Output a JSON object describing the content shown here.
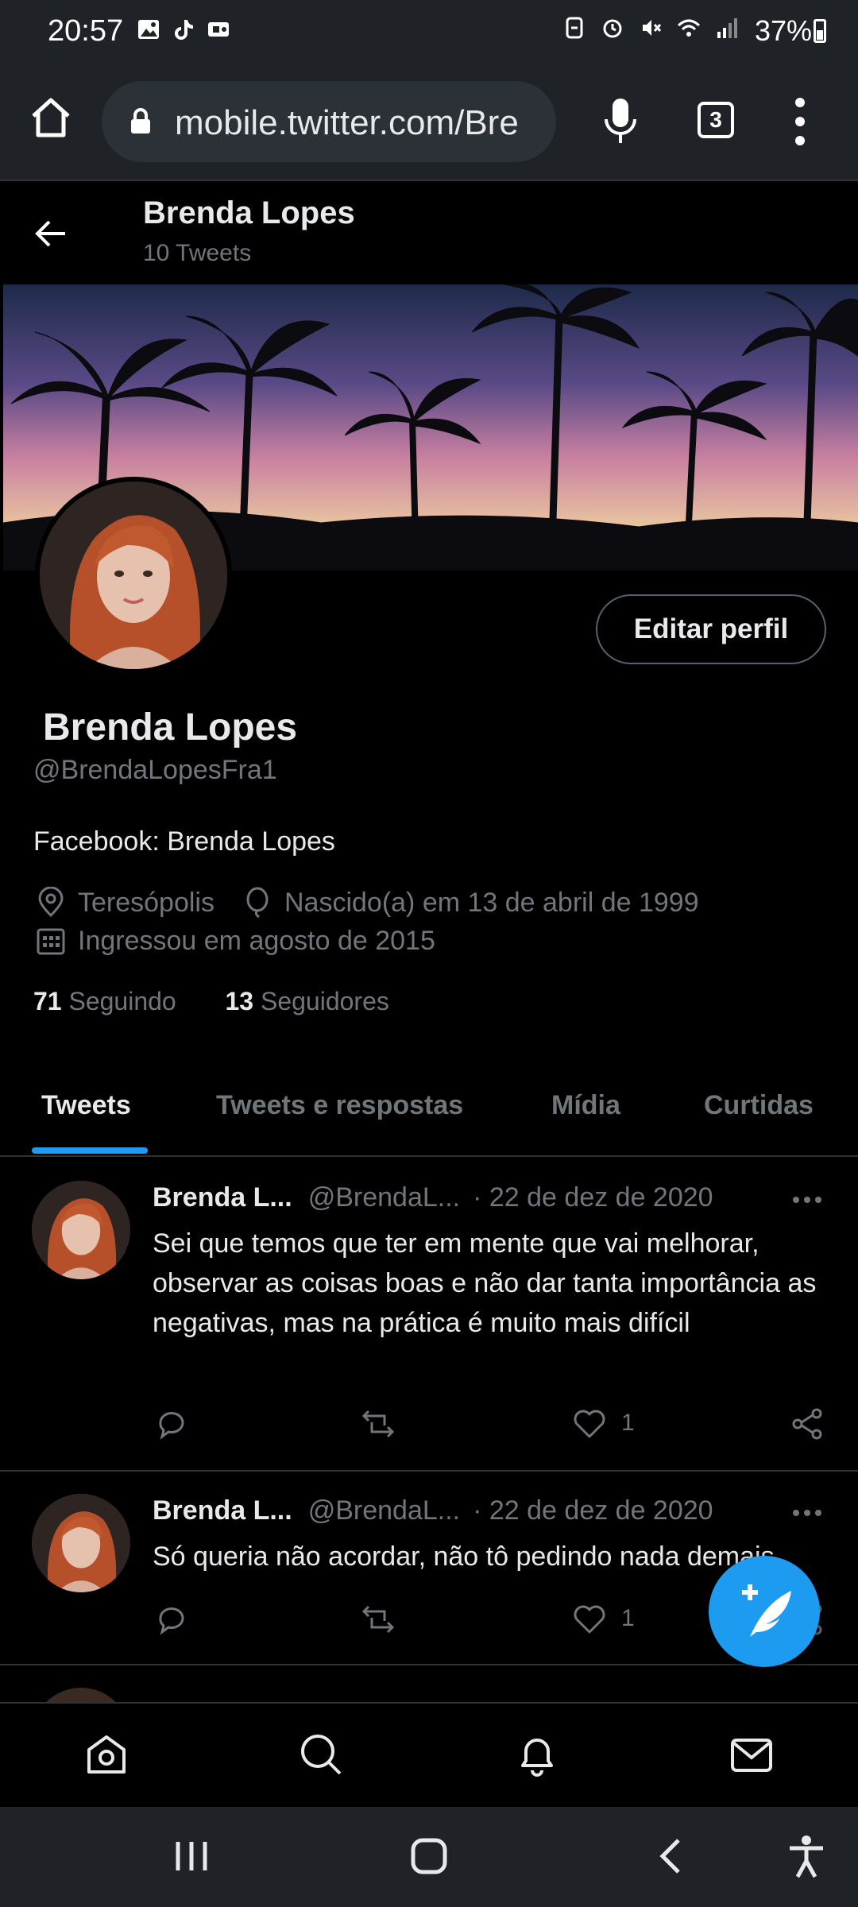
{
  "status_bar": {
    "time": "20:57",
    "battery": "37%",
    "icons_left": [
      "gallery-icon",
      "tiktok-icon",
      "vpn-icon"
    ],
    "icons_right": [
      "nfc-icon",
      "alarm-icon",
      "mute-icon",
      "wifi-icon",
      "signal-icon"
    ]
  },
  "browser": {
    "url": "mobile.twitter.com/Bre",
    "tab_count": "3"
  },
  "header": {
    "name": "Brenda Lopes",
    "tweet_count": "10 Tweets"
  },
  "profile": {
    "edit_button": "Editar perfil",
    "name": "Brenda Lopes",
    "handle": "@BrendaLopesFra1",
    "bio": "Facebook: Brenda Lopes",
    "location": "Teresópolis",
    "birthday": "Nascido(a) em 13 de abril de 1999",
    "joined": "Ingressou em agosto de 2015",
    "following_count": "71",
    "following_label": "Seguindo",
    "followers_count": "13",
    "followers_label": "Seguidores"
  },
  "tabs": [
    {
      "label": "Tweets",
      "active": true
    },
    {
      "label": "Tweets e respostas",
      "active": false
    },
    {
      "label": "Mídia",
      "active": false
    },
    {
      "label": "Curtidas",
      "active": false
    }
  ],
  "tweets": [
    {
      "name": "Brenda L...",
      "handle": "@BrendaL...",
      "date": "· 22 de dez de 2020",
      "text": "Sei que temos que ter em mente que vai melhorar, observar as coisas boas e não dar tanta importância as negativas, mas na prática é muito mais difícil",
      "likes": "1"
    },
    {
      "name": "Brenda L...",
      "handle": "@BrendaL...",
      "date": "· 22 de dez de 2020",
      "text": "Só queria não acordar, não tô pedindo nada demais",
      "likes": "1"
    }
  ],
  "colors": {
    "accent": "#1d9bf0",
    "background": "#000000",
    "secondary_text": "#71767b",
    "primary_text": "#e7e9ea",
    "divider": "#2f3336"
  }
}
